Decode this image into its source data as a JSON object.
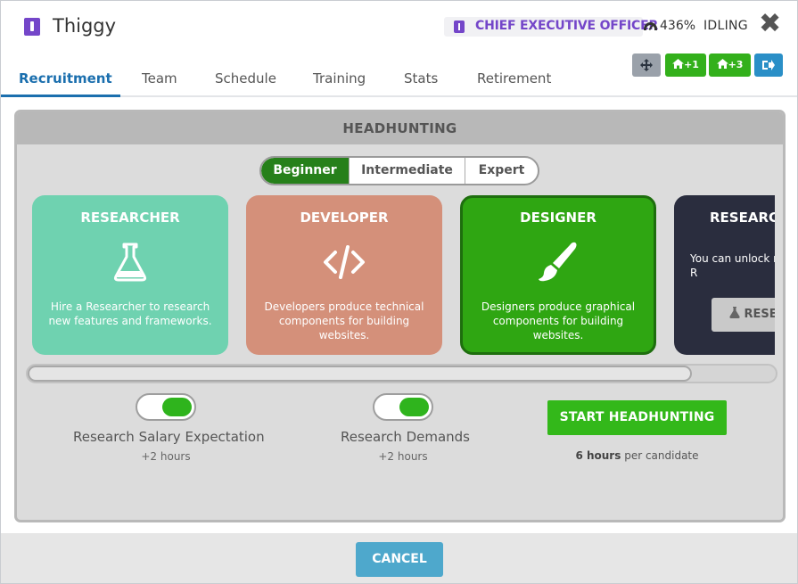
{
  "header": {
    "employee_name": "Thiggy",
    "role": "CHIEF EXECUTIVE OFFICER",
    "efficiency": "436%",
    "state": "IDLING",
    "close_glyph": "✖"
  },
  "tabs": [
    {
      "label": "Recruitment",
      "active": true
    },
    {
      "label": "Team"
    },
    {
      "label": "Schedule"
    },
    {
      "label": "Training"
    },
    {
      "label": "Stats"
    },
    {
      "label": "Retirement"
    }
  ],
  "header_buttons": {
    "move_icon": "move-icon",
    "plus1": "+1",
    "plus3": "+3",
    "exit_icon": "sign-out-icon"
  },
  "panel": {
    "title": "HEADHUNTING",
    "levels": [
      "Beginner",
      "Intermediate",
      "Expert"
    ],
    "selected_level": "Beginner",
    "cards": [
      {
        "title": "RESEARCHER",
        "icon": "flask-icon",
        "desc": "Hire a Researcher to research new features and frameworks.",
        "color": "#6fd2b0"
      },
      {
        "title": "DEVELOPER",
        "icon": "code-icon",
        "desc": "Developers produce technical components for building websites.",
        "color": "#d4907a"
      },
      {
        "title": "DESIGNER",
        "icon": "paintbrush-icon",
        "desc": "Designers produce graphical components for building websites.",
        "color": "#2fa612",
        "selected": true
      },
      {
        "title": "RESEARC",
        "icon": "lock",
        "desc": "You can unlock m types from the R",
        "button": "RESE",
        "color": "#2a2d3e"
      }
    ],
    "options": [
      {
        "label": "Research Salary Expectation",
        "sub": "+2 hours",
        "on": true
      },
      {
        "label": "Research Demands",
        "sub": "+2 hours",
        "on": true
      }
    ],
    "start_button": "START HEADHUNTING",
    "time_bold": "6 hours",
    "time_rest": "per candidate"
  },
  "footer": {
    "cancel": "CANCEL"
  }
}
